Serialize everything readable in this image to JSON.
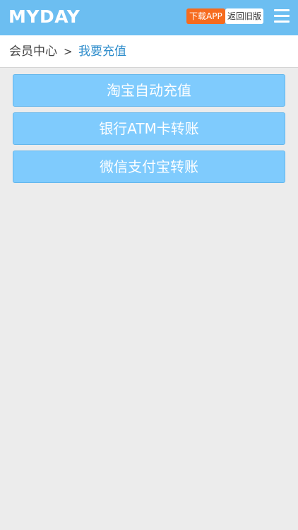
{
  "header": {
    "logo": "MYDAY",
    "download_label": "下载APP",
    "old_version_label": "返回旧版"
  },
  "breadcrumb": {
    "home": "会员中心",
    "separator": ">",
    "current": "我要充值"
  },
  "recharge_options": [
    {
      "label": "淘宝自动充值"
    },
    {
      "label": "银行ATM卡转账"
    },
    {
      "label": "微信支付宝转账"
    }
  ],
  "colors": {
    "header_bg": "#6cbef1",
    "download_bg": "#f66b1e",
    "option_bg": "#7fcbfd",
    "breadcrumb_current": "#2d8ccb"
  },
  "icons": {
    "menu": "hamburger-menu-icon"
  }
}
